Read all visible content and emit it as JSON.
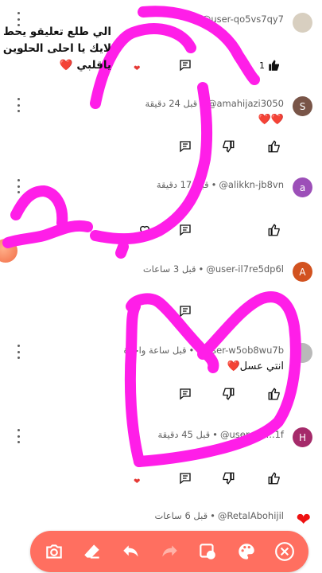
{
  "caption": {
    "text": "الي طلع تعليقو يحط لايك يا احلى الحلوين ياقلبي",
    "heart": "❤️"
  },
  "comments": [
    {
      "handle": "@user-qo5vs7qy7",
      "time": "",
      "text": "",
      "avatar_letter": "",
      "likes": "1",
      "avatar_color": "#d8cfc0"
    },
    {
      "handle": "@amahijazi3050",
      "time": "قبل 24 دقيقة",
      "text": "❤️❤️",
      "avatar_letter": "S",
      "likes": "",
      "avatar_color": "#795548"
    },
    {
      "handle": "@alikkn-jb8vn",
      "time": "قبل 17 دقيقة",
      "text": "",
      "avatar_letter": "a",
      "likes": "",
      "avatar_color": "#9c4fb8"
    },
    {
      "handle": "@user-il7re5dp6l",
      "time": "قبل 3 ساعات",
      "text": "",
      "avatar_letter": "A",
      "likes": "",
      "avatar_color": "#d2521f"
    },
    {
      "handle": "@user-w5ob8wu7b",
      "time": "قبل ساعة واحدة",
      "text": "انتي عسل❤️",
      "avatar_letter": "",
      "likes": "",
      "avatar_color": "#b9b9b9"
    },
    {
      "handle": "@user-cf7...1f",
      "time": "قبل 45 دقيقة",
      "text": "",
      "avatar_letter": "H",
      "likes": "",
      "avatar_color": "#a52a6a"
    },
    {
      "handle": "@RetalAbohijil",
      "time": "قبل 6 ساعات",
      "text": "",
      "avatar_letter": "",
      "likes": "",
      "avatar_color": "#e11"
    }
  ],
  "toolbar": {
    "items": [
      "camera-icon",
      "eraser-icon",
      "undo-icon",
      "redo-icon",
      "shape-icon",
      "palette-icon",
      "close-icon"
    ],
    "color": "#ff6f60"
  },
  "colors": {
    "pen": "#ff1ee8",
    "accent": "#ff6f60"
  }
}
